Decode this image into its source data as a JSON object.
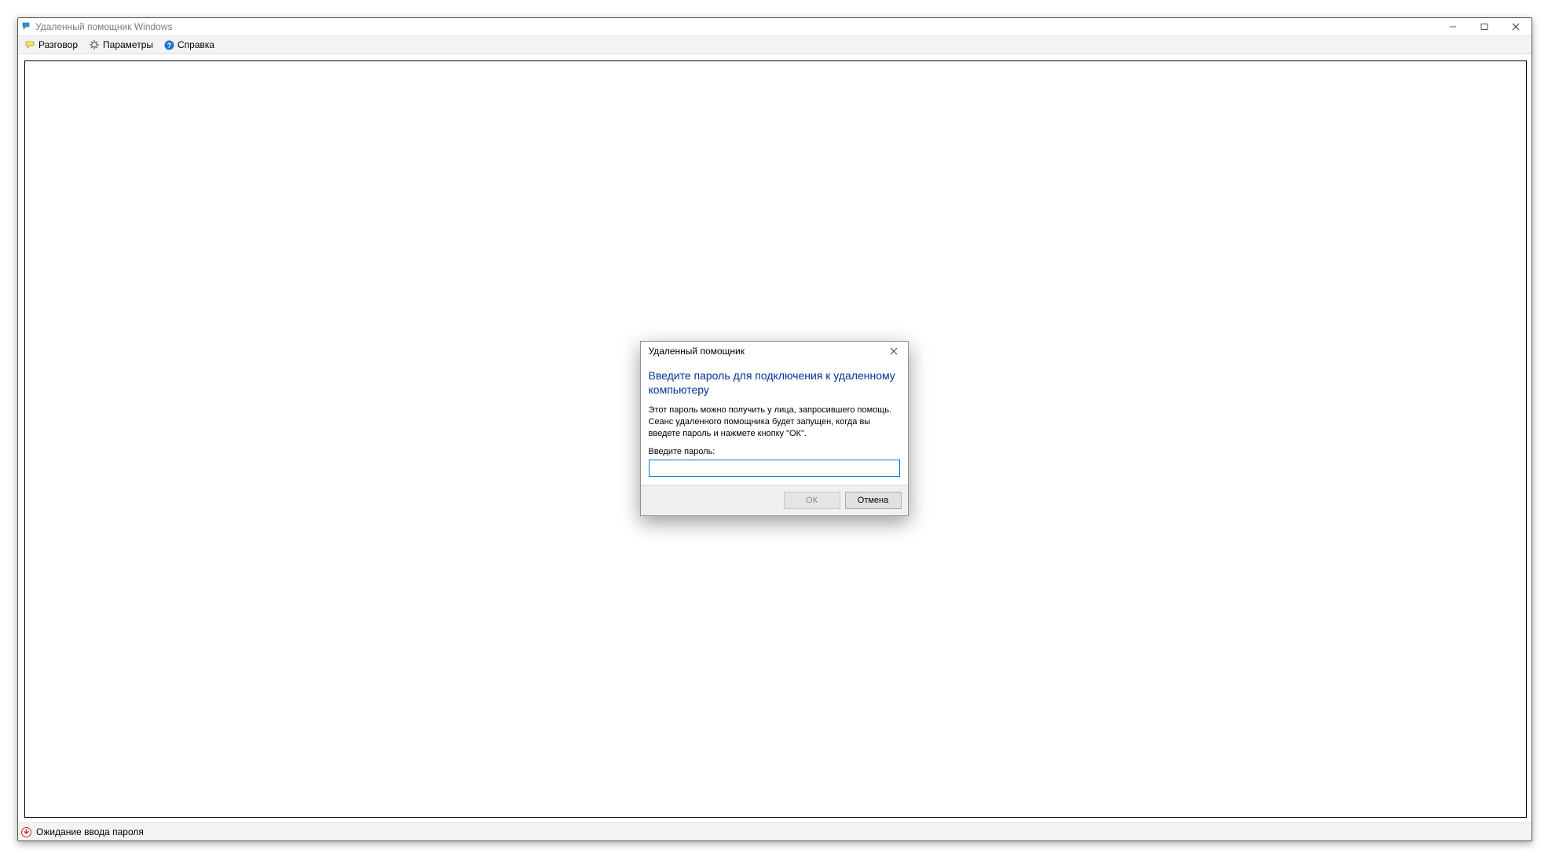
{
  "window": {
    "title": "Удаленный помощник Windows"
  },
  "menu": {
    "talk": "Разговор",
    "settings": "Параметры",
    "help": "Справка"
  },
  "status": {
    "text": "Ожидание ввода пароля"
  },
  "dialog": {
    "title": "Удаленный помощник",
    "heading": "Введите пароль для подключения к удаленному компьютеру",
    "description": "Этот пароль можно получить у лица, запросившего помощь. Сеанс удаленного помощника будет запущен, когда вы введете пароль и нажмете кнопку \"ОК\".",
    "input_label": "Введите пароль:",
    "input_value": "",
    "ok_label": "ОК",
    "cancel_label": "Отмена"
  }
}
